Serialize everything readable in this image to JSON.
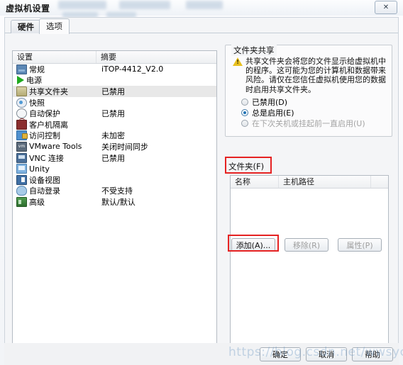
{
  "window": {
    "title": "虚拟机设置",
    "close_label": "✕"
  },
  "tabs": [
    {
      "label": "硬件",
      "active": false
    },
    {
      "label": "选项",
      "active": true
    }
  ],
  "settings_list": {
    "columns": [
      "设置",
      "摘要"
    ],
    "rows": [
      {
        "icon": "monitor-icon",
        "label": "常规",
        "summary": "iTOP-4412_V2.0",
        "selected": false
      },
      {
        "icon": "play-icon",
        "label": "电源",
        "summary": "",
        "selected": false
      },
      {
        "icon": "folder-icon",
        "label": "共享文件夹",
        "summary": "已禁用",
        "selected": true
      },
      {
        "icon": "camera-icon",
        "label": "快照",
        "summary": "",
        "selected": false
      },
      {
        "icon": "shield-icon",
        "label": "自动保护",
        "summary": "已禁用",
        "selected": false
      },
      {
        "icon": "lock-icon",
        "label": "客户机隔离",
        "summary": "",
        "selected": false
      },
      {
        "icon": "access-icon",
        "label": "访问控制",
        "summary": "未加密",
        "selected": false
      },
      {
        "icon": "vmware-tools-icon",
        "label": "VMware Tools",
        "summary": "关闭时间同步",
        "selected": false
      },
      {
        "icon": "vnc-icon",
        "label": "VNC 连接",
        "summary": "已禁用",
        "selected": false
      },
      {
        "icon": "unity-icon",
        "label": "Unity",
        "summary": "",
        "selected": false
      },
      {
        "icon": "device-view-icon",
        "label": "设备视图",
        "summary": "",
        "selected": false
      },
      {
        "icon": "user-icon",
        "label": "自动登录",
        "summary": "不受支持",
        "selected": false
      },
      {
        "icon": "advanced-icon",
        "label": "高级",
        "summary": "默认/默认",
        "selected": false
      }
    ]
  },
  "share_group": {
    "title": "文件夹共享",
    "warning_text": "共享文件夹会将您的文件显示给虚拟机中的程序。这可能为您的计算机和数据带来风险。请仅在您信任虚拟机使用您的数据时启用共享文件夹。",
    "options": [
      {
        "label": "已禁用(D)",
        "checked": false,
        "disabled": false
      },
      {
        "label": "总是启用(E)",
        "checked": true,
        "disabled": false
      },
      {
        "label": "在下次关机或挂起前一直启用(U)",
        "checked": false,
        "disabled": true
      }
    ]
  },
  "folders": {
    "label": "文件夹(F)",
    "columns": [
      "名称",
      "主机路径"
    ],
    "rows": [],
    "buttons": [
      {
        "label": "添加(A)...",
        "disabled": false,
        "highlighted": true
      },
      {
        "label": "移除(R)",
        "disabled": true,
        "highlighted": false
      },
      {
        "label": "属性(P)",
        "disabled": true,
        "highlighted": false
      }
    ]
  },
  "dialog_buttons": [
    {
      "label": "确定"
    },
    {
      "label": "取消"
    },
    {
      "label": "帮助"
    }
  ],
  "watermark": "https://blog.csdn.net/wwsycdsbn",
  "colors": {
    "highlight": "#e52222",
    "accent": "#1f72b5",
    "warning": "#e8c01f"
  }
}
